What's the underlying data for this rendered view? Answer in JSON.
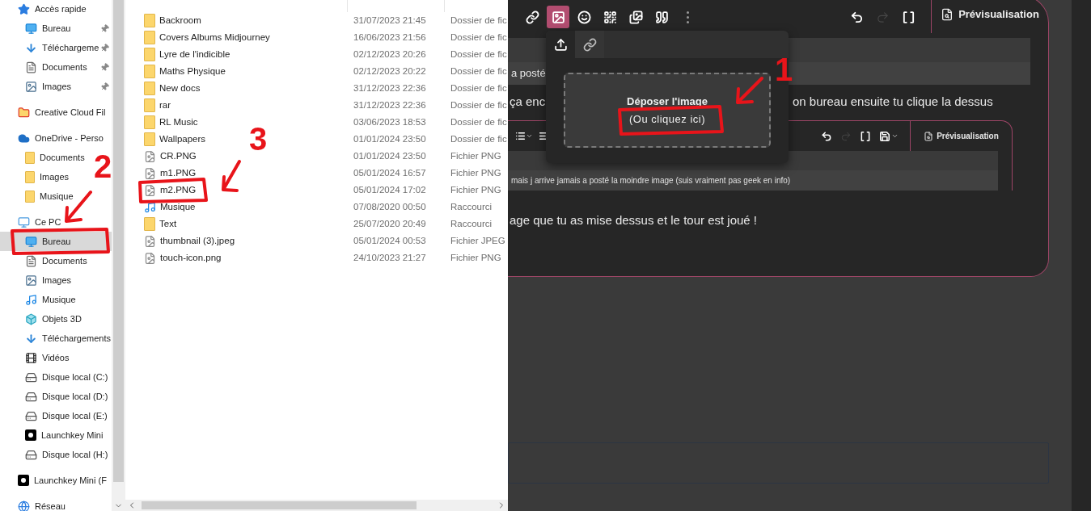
{
  "explorer": {
    "nav": [
      {
        "label": "Accès rapide",
        "kind": "star",
        "selected": false,
        "children": [
          {
            "label": "Bureau",
            "kind": "desktop",
            "selected": false,
            "pinned": true
          },
          {
            "label": "Téléchargeme",
            "kind": "download",
            "selected": false,
            "pinned": true
          },
          {
            "label": "Documents",
            "kind": "document",
            "selected": false,
            "pinned": true
          },
          {
            "label": "Images",
            "kind": "image",
            "selected": false,
            "pinned": true
          }
        ]
      },
      {
        "label": "Creative Cloud Fil",
        "kind": "creative-cloud",
        "selected": false
      },
      {
        "label": "OneDrive - Perso",
        "kind": "cloud",
        "selected": false,
        "children": [
          {
            "label": "Documents",
            "kind": "folder",
            "selected": false
          },
          {
            "label": "Images",
            "kind": "folder",
            "selected": false
          },
          {
            "label": "Musique",
            "kind": "folder",
            "selected": false
          }
        ]
      },
      {
        "label": "Ce PC",
        "kind": "pc",
        "selected": false,
        "children": [
          {
            "label": "Bureau",
            "kind": "desktop",
            "selected": true
          },
          {
            "label": "Documents",
            "kind": "document",
            "selected": false
          },
          {
            "label": "Images",
            "kind": "image",
            "selected": false
          },
          {
            "label": "Musique",
            "kind": "music",
            "selected": false
          },
          {
            "label": "Objets 3D",
            "kind": "cube",
            "selected": false
          },
          {
            "label": "Téléchargements",
            "kind": "download",
            "selected": false
          },
          {
            "label": "Vidéos",
            "kind": "video",
            "selected": false
          },
          {
            "label": "Disque local (C:)",
            "kind": "drive",
            "selected": false
          },
          {
            "label": "Disque local (D:)",
            "kind": "drive",
            "selected": false
          },
          {
            "label": "Disque local (E:)",
            "kind": "drive",
            "selected": false
          },
          {
            "label": "Launchkey Mini",
            "kind": "launchkey",
            "selected": false
          },
          {
            "label": "Disque local (H:)",
            "kind": "drive",
            "selected": false
          }
        ]
      },
      {
        "label": "Launchkey Mini (F",
        "kind": "launchkey",
        "selected": false
      },
      {
        "label": "Réseau",
        "kind": "network",
        "selected": false
      }
    ],
    "files": [
      {
        "name": "Backroom",
        "kind": "folder",
        "modified": "31/07/2023 21:45",
        "type": "Dossier de fic"
      },
      {
        "name": "Covers Albums Midjourney",
        "kind": "folder",
        "modified": "16/06/2023 21:56",
        "type": "Dossier de fic"
      },
      {
        "name": "Lyre de l'indicible",
        "kind": "folder",
        "modified": "02/12/2023 20:26",
        "type": "Dossier de fic"
      },
      {
        "name": "Maths Physique",
        "kind": "folder",
        "modified": "02/12/2023 20:22",
        "type": "Dossier de fic"
      },
      {
        "name": "New docs",
        "kind": "folder",
        "modified": "31/12/2023 22:36",
        "type": "Dossier de fic"
      },
      {
        "name": "rar",
        "kind": "folder",
        "modified": "31/12/2023 22:36",
        "type": "Dossier de fic"
      },
      {
        "name": "RL Music",
        "kind": "folder",
        "modified": "03/06/2023 18:53",
        "type": "Dossier de fic"
      },
      {
        "name": "Wallpapers",
        "kind": "folder",
        "modified": "01/01/2024 23:50",
        "type": "Dossier de fic"
      },
      {
        "name": "CR.PNG",
        "kind": "file",
        "modified": "01/01/2024 23:50",
        "type": "Fichier PNG"
      },
      {
        "name": "m1.PNG",
        "kind": "file",
        "modified": "05/01/2024 16:57",
        "type": "Fichier PNG"
      },
      {
        "name": "m2.PNG",
        "kind": "file",
        "modified": "05/01/2024 17:02",
        "type": "Fichier PNG"
      },
      {
        "name": "Musique",
        "kind": "music-shortcut",
        "modified": "07/08/2020 00:50",
        "type": "Raccourci"
      },
      {
        "name": "Text",
        "kind": "folder-shortcut",
        "modified": "25/07/2020 20:49",
        "type": "Raccourci"
      },
      {
        "name": "thumbnail (3).jpeg",
        "kind": "file",
        "modified": "05/01/2024 00:53",
        "type": "Fichier JPEG"
      },
      {
        "name": "touch-icon.png",
        "kind": "file",
        "modified": "24/10/2023 21:27",
        "type": "Fichier PNG"
      }
    ]
  },
  "editor": {
    "toolbar": [
      {
        "kind": "link",
        "selected": false
      },
      {
        "kind": "image",
        "selected": true
      },
      {
        "kind": "emoji",
        "selected": false
      },
      {
        "kind": "qr",
        "selected": false
      },
      {
        "kind": "gallery",
        "selected": false
      },
      {
        "kind": "quote",
        "selected": false
      },
      {
        "kind": "more",
        "selected": false
      }
    ],
    "history": [
      {
        "kind": "undo",
        "disabled": false
      },
      {
        "kind": "redo",
        "disabled": true
      },
      {
        "kind": "fullscreen",
        "disabled": false
      }
    ],
    "preview_tab": "Prévisualisation",
    "quote_text": "a posté",
    "line_1_start": "ça enc",
    "line_1_end": "on bureau ensuite tu clique la dessus",
    "inner_screenshot": {
      "toolbar": [
        {
          "kind": "list"
        },
        {
          "kind": "align"
        }
      ],
      "history": [
        {
          "kind": "undo",
          "disabled": false
        },
        {
          "kind": "redo",
          "disabled": true
        },
        {
          "kind": "fullscreen",
          "disabled": false
        },
        {
          "kind": "save",
          "disabled": false
        }
      ],
      "preview_tab": "Prévisualisation",
      "quote_text": "mais j arrive jamais a posté la moindre image (suis vraiment pas geek en info)"
    },
    "line_2": "age que tu as mise dessus et le tour est joué !"
  },
  "upload_popup": {
    "tabs": [
      {
        "kind": "upload",
        "selected": true
      },
      {
        "kind": "link",
        "selected": false
      }
    ],
    "drop_title": "Déposer l'image",
    "drop_hint": "(Ou cliquez ici)"
  },
  "annotations": [
    {
      "label": "1"
    },
    {
      "label": "2"
    },
    {
      "label": "3"
    }
  ]
}
